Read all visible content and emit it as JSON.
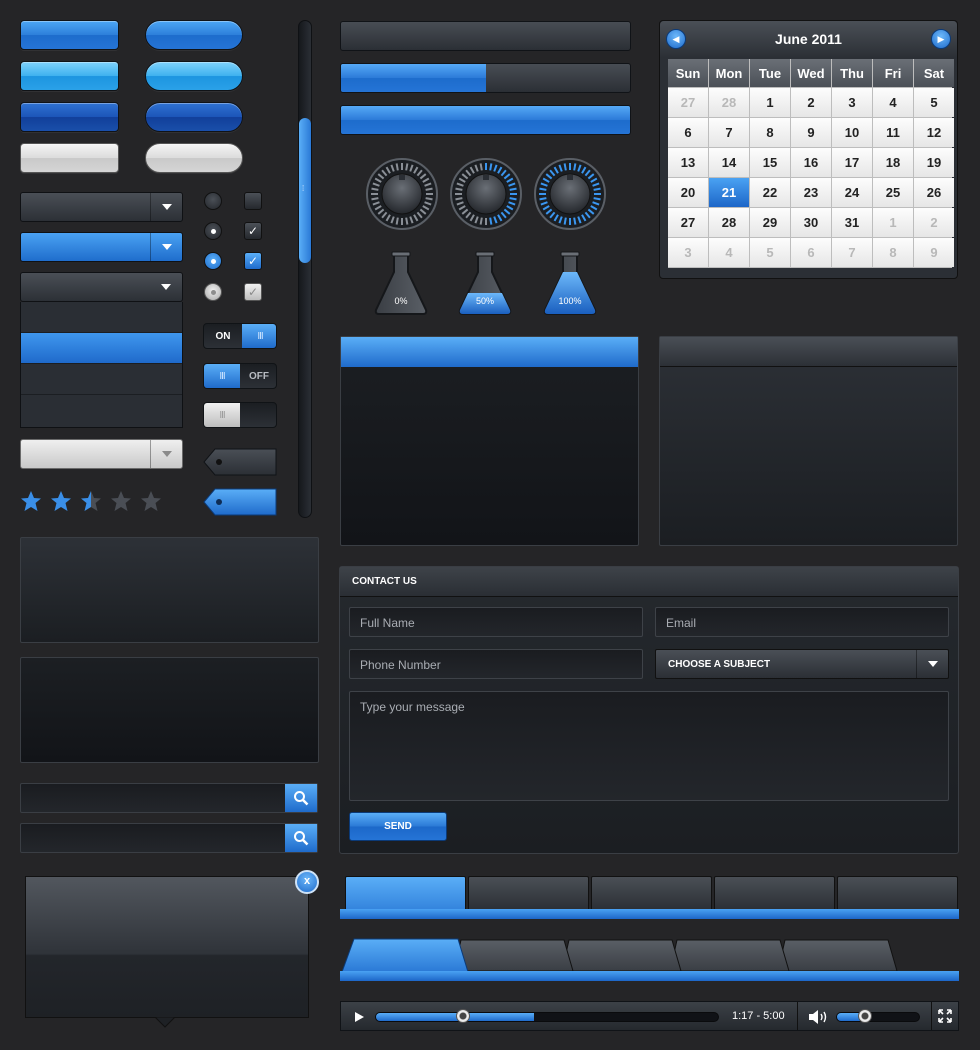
{
  "colors": {
    "background": "#252527",
    "accent_blue": "#2b7ad8",
    "panel_dark": "#1b1e22"
  },
  "stars": {
    "rating": 2.5,
    "max": 5
  },
  "toggles": {
    "on_label": "ON",
    "off_label": "OFF",
    "grip": "III"
  },
  "knobs": [
    {
      "level": 0
    },
    {
      "level": 0.5
    },
    {
      "level": 1
    }
  ],
  "flasks": [
    {
      "label": "0%",
      "fill": 0
    },
    {
      "label": "50%",
      "fill": 0.5
    },
    {
      "label": "100%",
      "fill": 1
    }
  ],
  "progress_bars": [
    {
      "value": 0
    },
    {
      "value": 0.5
    },
    {
      "value": 1
    }
  ],
  "calendar": {
    "title": "June 2011",
    "prev_icon": "arrow-left-icon",
    "next_icon": "arrow-right-icon",
    "weekdays": [
      "Sun",
      "Mon",
      "Tue",
      "Wed",
      "Thu",
      "Fri",
      "Sat"
    ],
    "weeks": [
      [
        "27",
        "28",
        "1",
        "2",
        "3",
        "4",
        "5"
      ],
      [
        "6",
        "7",
        "8",
        "9",
        "10",
        "11",
        "12"
      ],
      [
        "13",
        "14",
        "15",
        "16",
        "17",
        "18",
        "19"
      ],
      [
        "20",
        "21",
        "22",
        "23",
        "24",
        "25",
        "26"
      ],
      [
        "27",
        "28",
        "29",
        "30",
        "31",
        "1",
        "2"
      ],
      [
        "3",
        "4",
        "5",
        "6",
        "7",
        "8",
        "9"
      ]
    ],
    "selected_day": "21"
  },
  "contact": {
    "title": "CONTACT US",
    "full_name_placeholder": "Full Name",
    "email_placeholder": "Email",
    "phone_placeholder": "Phone Number",
    "subject_label": "CHOOSE A SUBJECT",
    "message_placeholder": "Type your message",
    "send_label": "SEND"
  },
  "player": {
    "time": "1:17 - 5:00",
    "progress": 0.257,
    "volume": 0.35,
    "play_icon": "play-icon",
    "volume_icon": "speaker-icon",
    "fullscreen_icon": "fullscreen-icon"
  },
  "tooltip": {
    "close_label": "x"
  }
}
